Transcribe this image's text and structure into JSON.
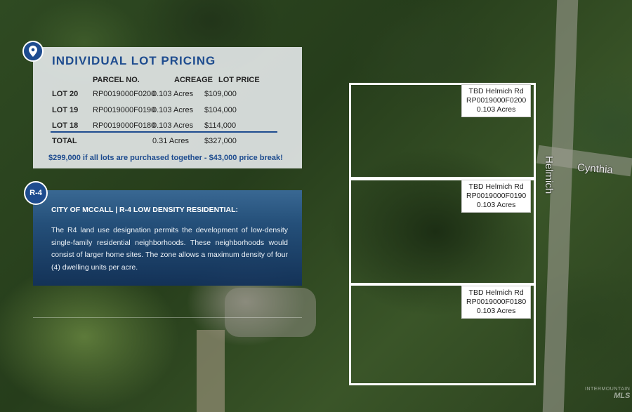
{
  "pricing": {
    "title": "INDIVIDUAL LOT PRICING",
    "headers": {
      "parcel": "PARCEL NO.",
      "acreage": "ACREAGE",
      "price": "LOT PRICE"
    },
    "rows": [
      {
        "lot": "LOT 20",
        "parcel": "RP0019000F0200",
        "acreage": "0.103 Acres",
        "price": "$109,000"
      },
      {
        "lot": "LOT 19",
        "parcel": "RP0019000F0190",
        "acreage": "0.103 Acres",
        "price": "$104,000"
      },
      {
        "lot": "LOT 18",
        "parcel": "RP0019000F0180",
        "acreage": "0.103 Acres",
        "price": "$114,000"
      }
    ],
    "total": {
      "label": "TOTAL",
      "acreage": "0.31 Acres",
      "price": "$327,000"
    },
    "promo": "$299,000 if all lots are purchased together - $43,000 price break!"
  },
  "zoning": {
    "badge": "R-4",
    "title": "CITY OF MCCALL | R-4 LOW DENSITY RESIDENTIAL:",
    "description": "The R4 land use designation permits the development of low-density single-family residential neighborhoods. These neighborhoods would consist of larger home sites. The zone allows a maximum density of four (4) dwelling units per acre."
  },
  "lots": [
    {
      "line1": "TBD Helmich Rd",
      "line2": "RP0019000F0200",
      "line3": "0.103 Acres"
    },
    {
      "line1": "TBD Helmich Rd",
      "line2": "RP0019000F0190",
      "line3": "0.103 Acres"
    },
    {
      "line1": "TBD Helmich Rd",
      "line2": "RP0019000F0180",
      "line3": "0.103 Acres"
    }
  ],
  "streets": {
    "helmich": "Helmich",
    "cynthia": "Cynthia"
  },
  "watermark": {
    "line1": "INTERMOUNTAIN",
    "line2": "MLS"
  },
  "colors": {
    "accent": "#1e4c8f",
    "panel": "#ebeef0",
    "zone_panel": "#24507e"
  }
}
